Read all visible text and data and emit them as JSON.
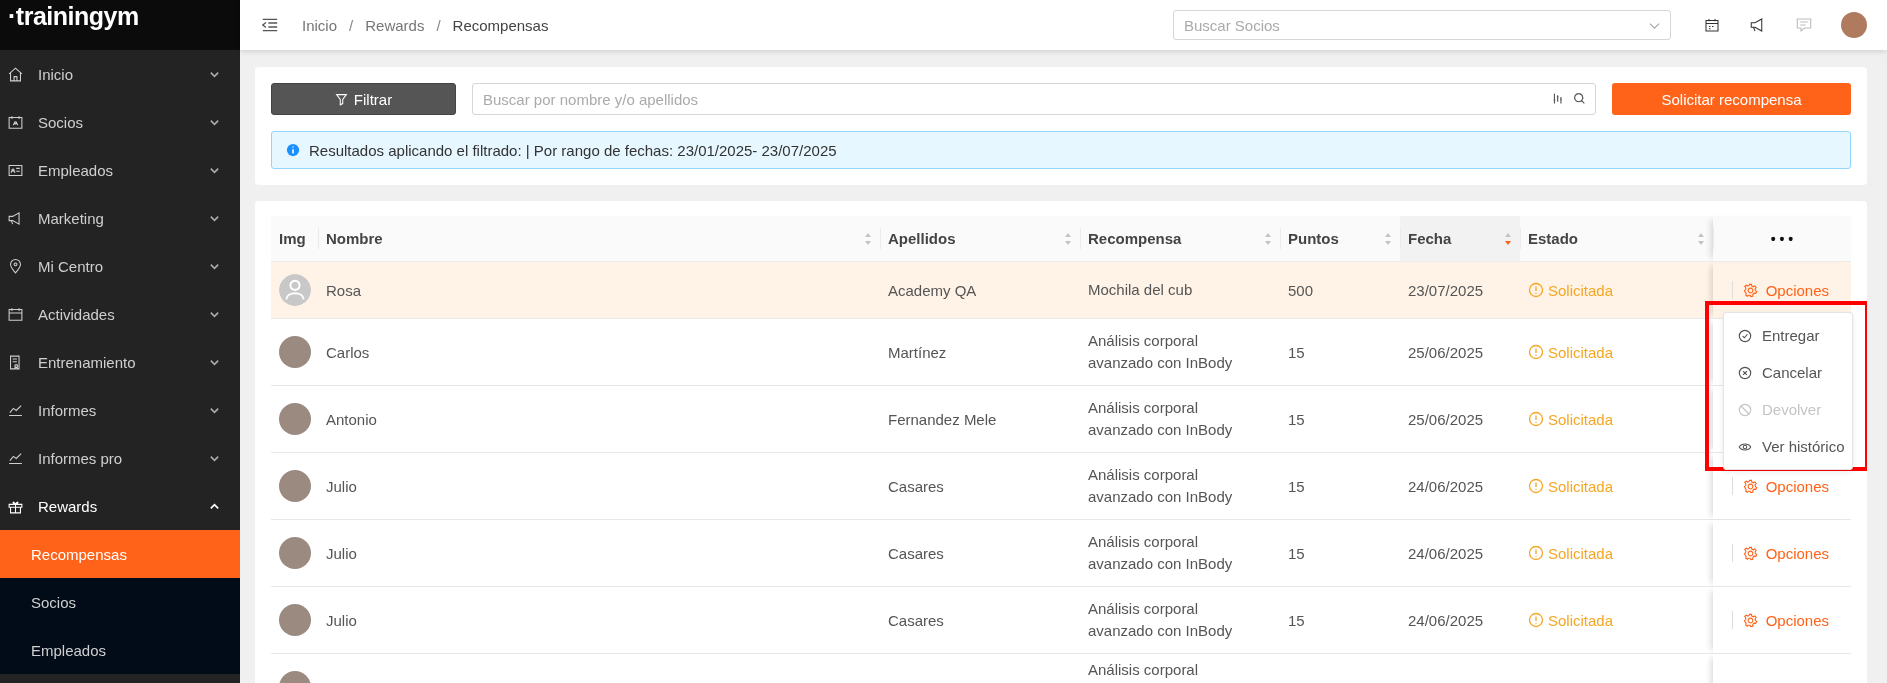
{
  "brand": {
    "logo": "·trainingym"
  },
  "sidebar": {
    "items": [
      {
        "label": "Inicio",
        "expanded": false
      },
      {
        "label": "Socios",
        "expanded": false
      },
      {
        "label": "Empleados",
        "expanded": false
      },
      {
        "label": "Marketing",
        "expanded": false
      },
      {
        "label": "Mi Centro",
        "expanded": false
      },
      {
        "label": "Actividades",
        "expanded": false
      },
      {
        "label": "Entrenamiento",
        "expanded": false
      },
      {
        "label": "Informes",
        "expanded": false
      },
      {
        "label": "Informes pro",
        "expanded": false
      },
      {
        "label": "Rewards",
        "expanded": true,
        "children": [
          {
            "label": "Recompensas",
            "selected": true
          },
          {
            "label": "Socios",
            "selected": false
          },
          {
            "label": "Empleados",
            "selected": false
          }
        ]
      }
    ]
  },
  "header": {
    "breadcrumb": [
      {
        "label": "Inicio",
        "separator": "/"
      },
      {
        "label": "Rewards",
        "separator": "/"
      },
      {
        "label": "Recompensas"
      }
    ],
    "member_search": {
      "placeholder": "Buscar Socios"
    }
  },
  "filters": {
    "filter_button": "Filtrar",
    "search": {
      "placeholder": "Buscar por nombre y/o apellidos"
    },
    "request_button": "Solicitar recompensa",
    "info": "Resultados aplicando el filtrado: | Por rango de fechas: 23/01/2025- 23/07/2025"
  },
  "table": {
    "columns": [
      {
        "label": "Img",
        "sortable": false
      },
      {
        "label": "Nombre",
        "sortable": true,
        "sorted": false
      },
      {
        "label": "Apellidos",
        "sortable": true,
        "sorted": false
      },
      {
        "label": "Recompensa",
        "sortable": true,
        "sorted": false
      },
      {
        "label": "Puntos",
        "sortable": true,
        "sorted": false
      },
      {
        "label": "Fecha",
        "sortable": true,
        "sorted": true
      },
      {
        "label": "Estado",
        "sortable": true,
        "sorted": false
      },
      {
        "label": "• • •",
        "sortable": false
      }
    ],
    "rows": [
      {
        "has_photo": false,
        "nombre": "Rosa",
        "apellidos": "Academy QA",
        "recompensa": "Mochila del cub",
        "puntos": "500",
        "fecha": "23/07/2025",
        "estado": "Solicitada",
        "options": "Opciones",
        "selected": true
      },
      {
        "has_photo": true,
        "nombre": "Carlos",
        "apellidos": "Martínez",
        "recompensa": "Análisis corporal avanzado con InBody",
        "puntos": "15",
        "fecha": "25/06/2025",
        "estado": "Solicitada",
        "selected": false
      },
      {
        "has_photo": true,
        "nombre": "Antonio",
        "apellidos": "Fernandez Mele",
        "recompensa": "Análisis corporal avanzado con InBody",
        "puntos": "15",
        "fecha": "25/06/2025",
        "estado": "Solicitada",
        "selected": false
      },
      {
        "has_photo": true,
        "nombre": "Julio",
        "apellidos": "Casares",
        "recompensa": "Análisis corporal avanzado con InBody",
        "puntos": "15",
        "fecha": "24/06/2025",
        "estado": "Solicitada",
        "options": "Opciones",
        "selected": false
      },
      {
        "has_photo": true,
        "nombre": "Julio",
        "apellidos": "Casares",
        "recompensa": "Análisis corporal avanzado con InBody",
        "puntos": "15",
        "fecha": "24/06/2025",
        "estado": "Solicitada",
        "options": "Opciones",
        "selected": false
      },
      {
        "has_photo": true,
        "nombre": "Julio",
        "apellidos": "Casares",
        "recompensa": "Análisis corporal avanzado con InBody",
        "puntos": "15",
        "fecha": "24/06/2025",
        "estado": "Solicitada",
        "options": "Opciones",
        "selected": false
      },
      {
        "has_photo": true,
        "recompensa": "Análisis corporal",
        "selected": false
      }
    ]
  },
  "options_menu": {
    "items": [
      {
        "kind": "deliver",
        "label": "Entregar",
        "disabled": false
      },
      {
        "kind": "cancel",
        "label": "Cancelar",
        "disabled": false
      },
      {
        "kind": "return",
        "label": "Devolver",
        "disabled": true
      },
      {
        "kind": "history",
        "label": "Ver histórico",
        "disabled": false
      }
    ]
  }
}
